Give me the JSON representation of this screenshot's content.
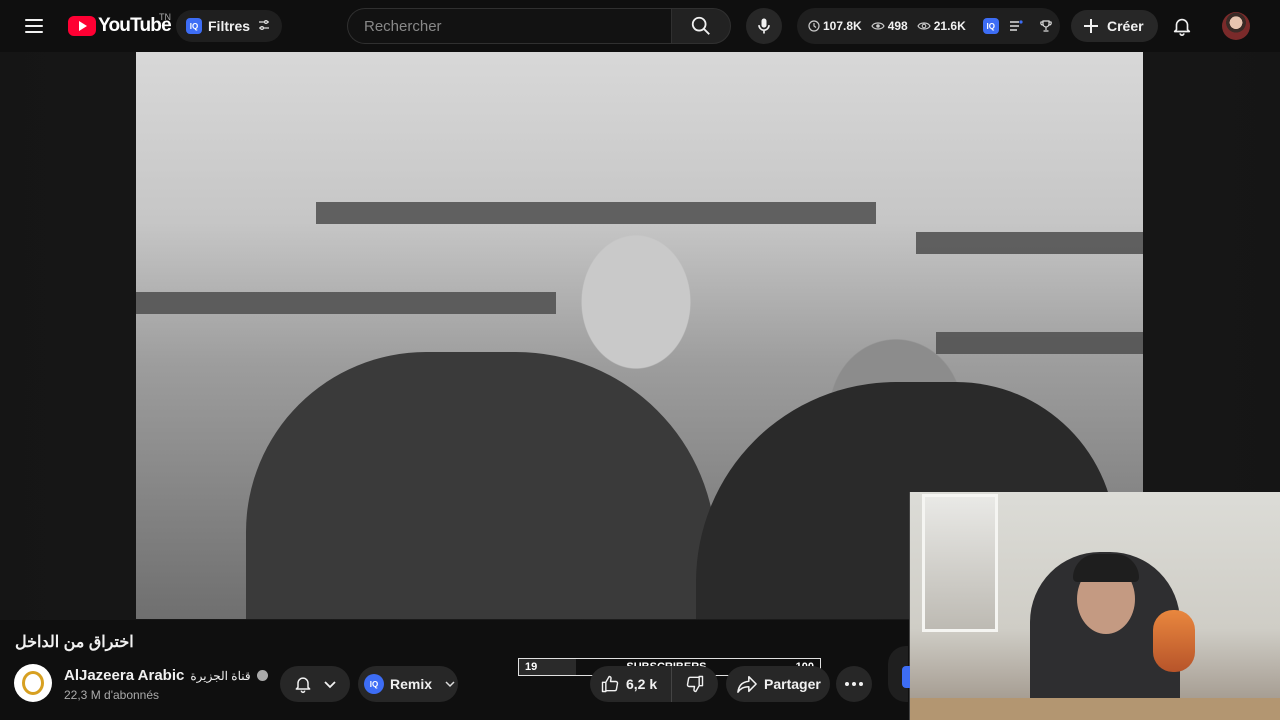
{
  "header": {
    "logo_text": "YouTube",
    "region_code": "TN",
    "filters_badge": "IQ",
    "filters_label": "Filtres",
    "search_placeholder": "Rechercher",
    "create_label": "Créer"
  },
  "stats": {
    "views": "107.8K",
    "watching": "498",
    "secondary_views": "21.6K",
    "badge": "IQ"
  },
  "video": {
    "title": "اختراق من الداخل",
    "content_description": "black-and-white archival footage of two men in suits talking in a courtroom"
  },
  "channel": {
    "name": "AlJazeera Arabic",
    "name_arabic": "قناة الجزيرة",
    "subscribers": "22,3 M d'abonnés"
  },
  "actions": {
    "remix_badge": "IQ",
    "remix_label": "Remix",
    "like_count": "6,2 k",
    "share_label": "Partager"
  },
  "subscriber_goal": {
    "current": "19",
    "label": "SUBSCRIBERS",
    "target": "100",
    "progress": 0.19
  },
  "colors": {
    "accent_red": "#ff0033",
    "iq_blue": "#3d6df5",
    "background": "#0f0f0f",
    "chip": "#272727"
  }
}
